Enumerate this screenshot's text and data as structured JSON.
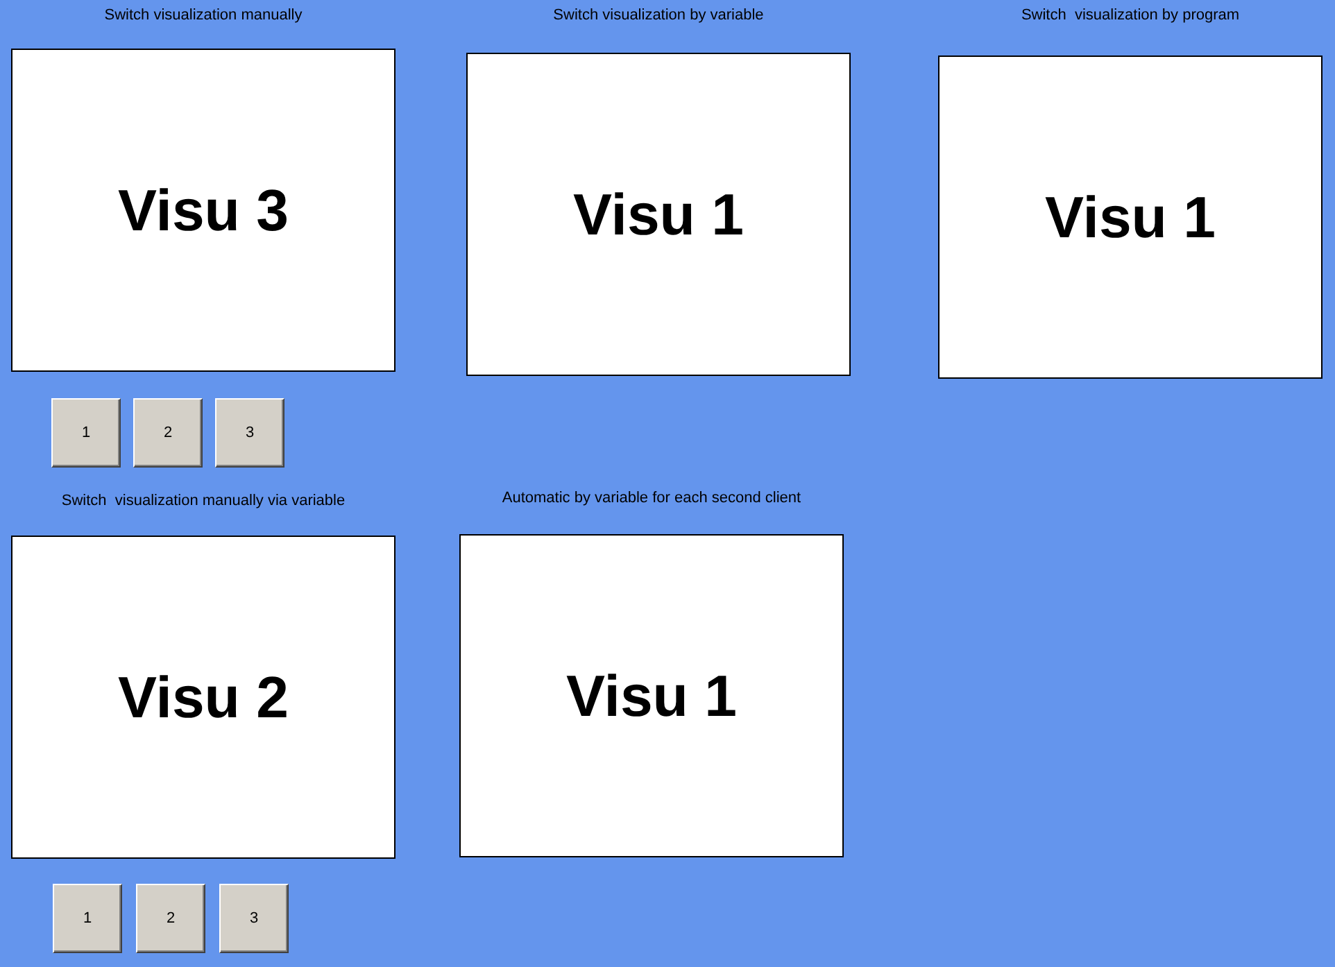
{
  "panels": [
    {
      "title": "Switch visualization manually",
      "frame_text": "Visu 3",
      "buttons": [
        "1",
        "2",
        "3"
      ]
    },
    {
      "title": "Switch visualization by variable",
      "frame_text": "Visu 1"
    },
    {
      "title": "Switch  visualization by program",
      "frame_text": "Visu 1"
    },
    {
      "title": "Switch  visualization manually via variable",
      "frame_text": "Visu 2",
      "buttons": [
        "1",
        "2",
        "3"
      ]
    },
    {
      "title": "Automatic by variable for each second client",
      "frame_text": "Visu 1"
    }
  ]
}
